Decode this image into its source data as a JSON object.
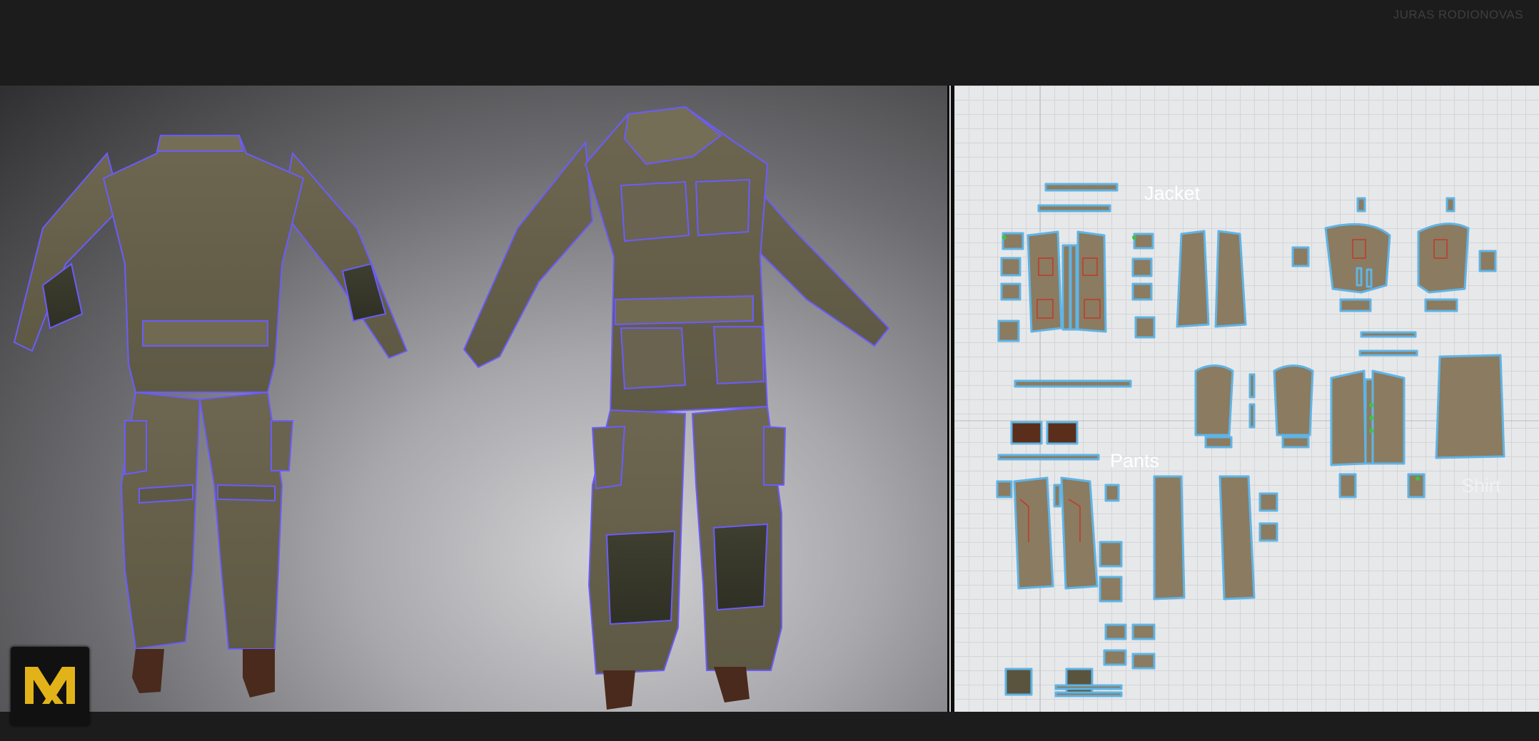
{
  "header": {
    "credit": "JURAS RODIONOVAS"
  },
  "viewport": {
    "description_label": ""
  },
  "pattern_panel": {
    "labels": {
      "jacket": "Jacket",
      "pants": "Pants",
      "shirt": "Shirt"
    }
  },
  "logo": {
    "name": "marvelous-designer-logo",
    "mark": "MD"
  },
  "colors": {
    "fabric": "#6e6650",
    "fabric_dark": "#4a4836",
    "seam": "#6b5cff",
    "outline": "#5fb4e6",
    "boot": "#4a2a1c",
    "logo_gold": "#e2b319"
  }
}
